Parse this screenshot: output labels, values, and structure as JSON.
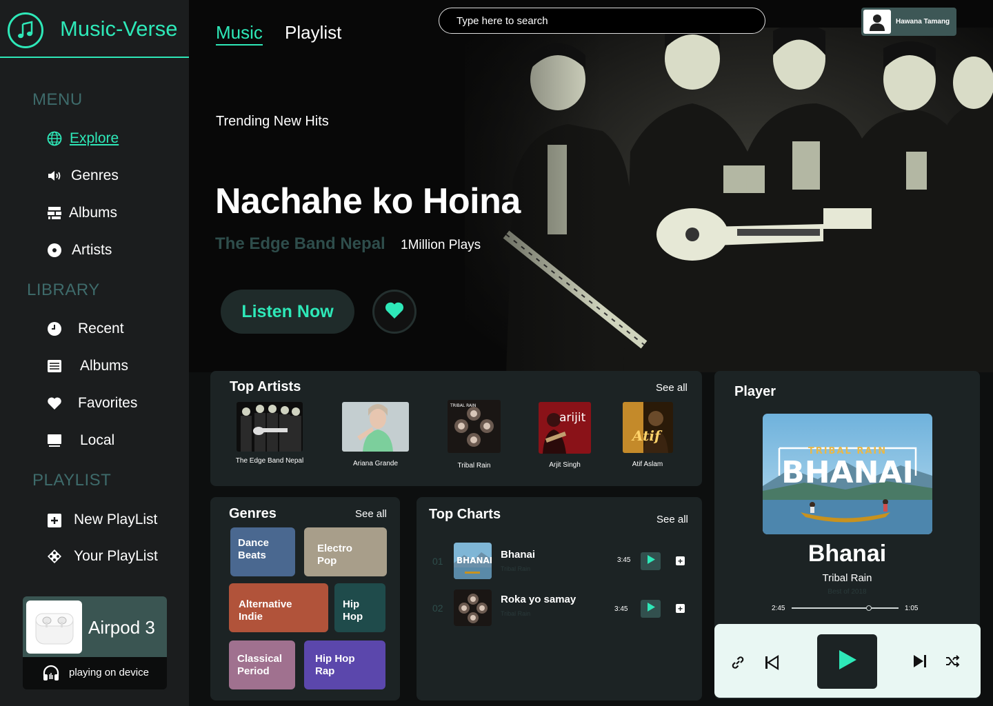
{
  "brand": {
    "name": "Music-Verse",
    "accent": "#2ee8b8"
  },
  "sidebar": {
    "menu_heading": "MENU",
    "menu": [
      {
        "label": "Explore",
        "icon": "globe-icon",
        "active": true
      },
      {
        "label": "Genres",
        "icon": "speaker-icon"
      },
      {
        "label": "Albums",
        "icon": "albums-stack-icon"
      },
      {
        "label": "Artists",
        "icon": "disc-icon"
      }
    ],
    "library_heading": "LIBRARY",
    "library": [
      {
        "label": "Recent",
        "icon": "clock-icon"
      },
      {
        "label": "Albums",
        "icon": "list-icon"
      },
      {
        "label": "Favorites",
        "icon": "heart-icon"
      },
      {
        "label": "Local",
        "icon": "monitor-icon"
      }
    ],
    "playlist_heading": "PLAYLIST",
    "playlist": [
      {
        "label": "New PlayList",
        "icon": "plus-square-icon"
      },
      {
        "label": "Your PlayList",
        "icon": "playlist-icon"
      }
    ],
    "device": {
      "name": "Airpod 3",
      "status": "playing on device"
    }
  },
  "header": {
    "tabs": [
      {
        "label": "Music",
        "active": true
      },
      {
        "label": "Playlist"
      }
    ],
    "search_placeholder": "Type here to search",
    "user_name": "Hawana Tamang"
  },
  "hero": {
    "kicker": "Trending New Hits",
    "title": "Nachahe ko Hoina",
    "artist": "The Edge Band Nepal",
    "plays": "1Million Plays",
    "listen_label": "Listen Now"
  },
  "top_artists": {
    "title": "Top Artists",
    "see_all": "See all",
    "items": [
      {
        "name": "The Edge Band Nepal"
      },
      {
        "name": "Ariana Grande"
      },
      {
        "name": "Tribal Rain"
      },
      {
        "name": "Arjit Singh"
      },
      {
        "name": "Atif Aslam"
      }
    ]
  },
  "genres": {
    "title": "Genres",
    "see_all": "See all",
    "items": [
      {
        "label": "Dance Beats",
        "color": "#4a6890"
      },
      {
        "label": "Electro Pop",
        "color": "#a89e8a"
      },
      {
        "label": "Alternative Indie",
        "color": "#b1533a"
      },
      {
        "label": "Hip Hop",
        "color": "#1f4b4b"
      },
      {
        "label": "Classical Period",
        "color": "#a0718f"
      },
      {
        "label": "Hip Hop Rap",
        "color": "#5b47ac"
      }
    ]
  },
  "top_charts": {
    "title": "Top Charts",
    "see_all": "See all",
    "items": [
      {
        "num": "01",
        "title": "Bhanai",
        "artist": "Tribal Rain",
        "duration": "3:45"
      },
      {
        "num": "02",
        "title": "Roka yo samay",
        "artist": "Tribal Rain",
        "duration": "3:45"
      }
    ]
  },
  "player": {
    "title": "Player",
    "song": "Bhanai",
    "artist": "Tribal Rain",
    "album": "Best of 2018",
    "elapsed": "2:45",
    "remaining": "1:05",
    "progress": 0.72,
    "art_text_top": "TRIBAL RAIN",
    "art_text_main": "BHANAI"
  },
  "artist_art": {
    "tribal_text": "TRIBAL RAIN",
    "arijit_text": "arijit",
    "atif_text": "Atif"
  }
}
